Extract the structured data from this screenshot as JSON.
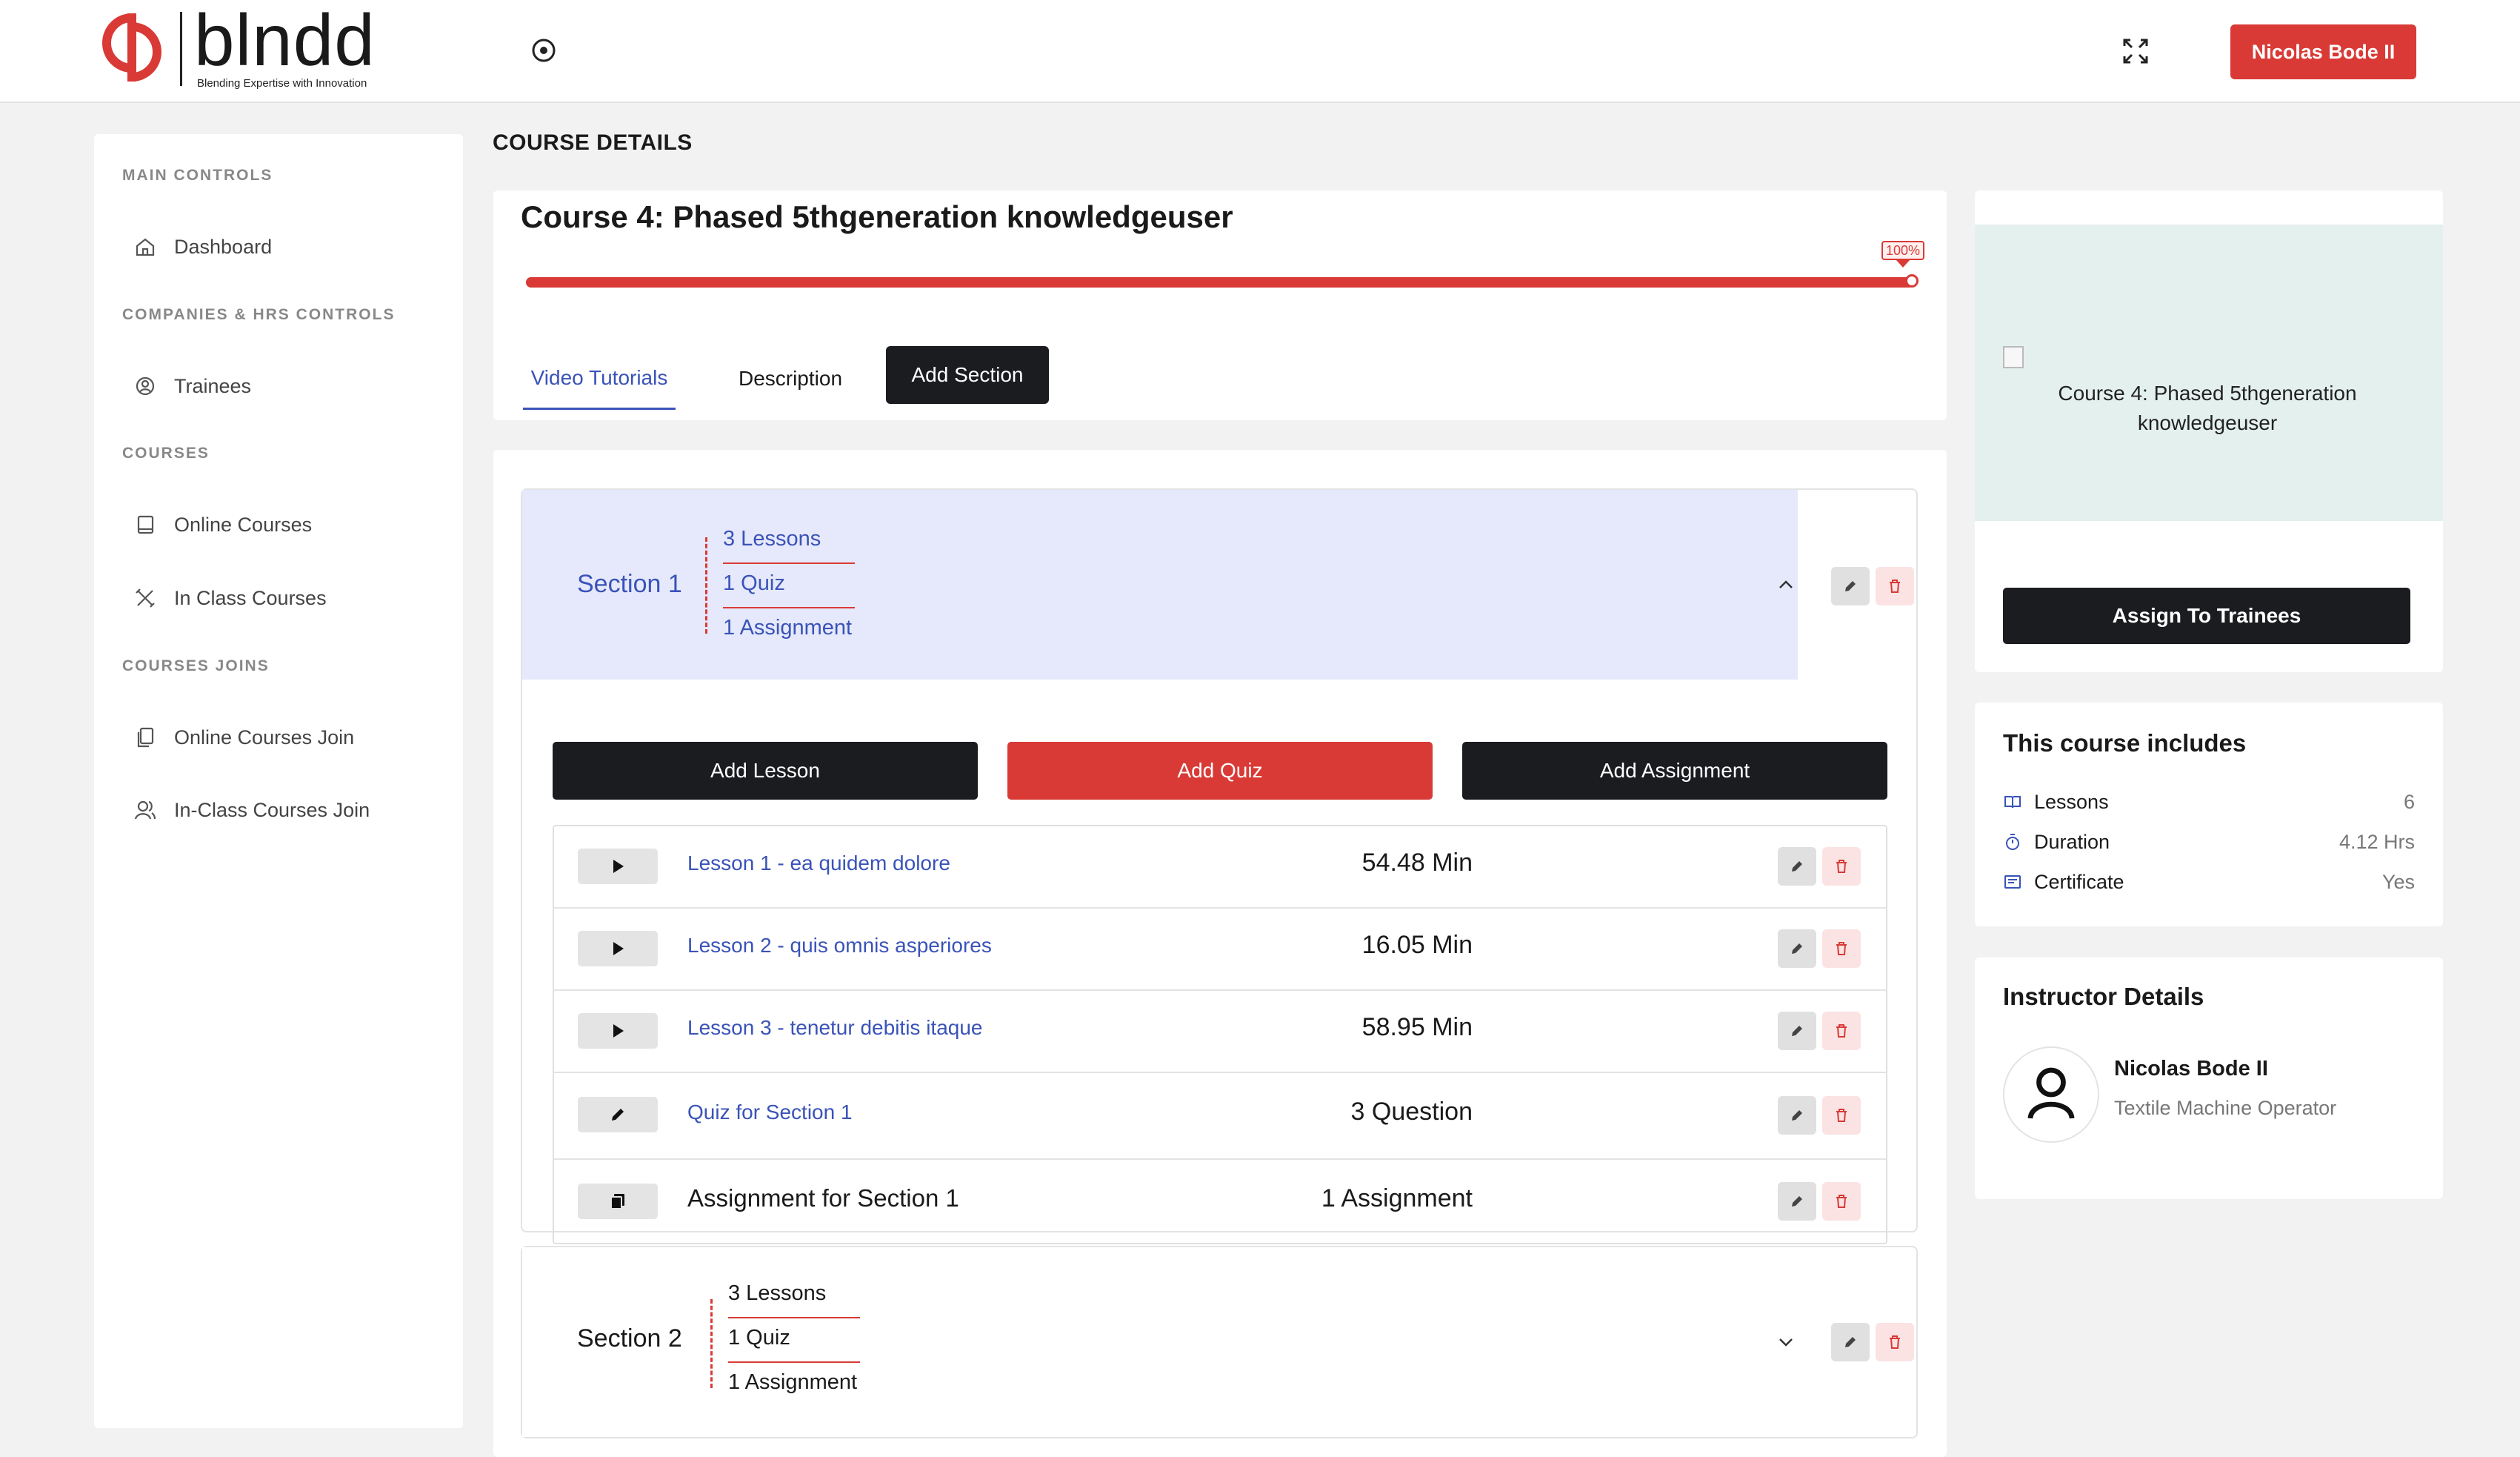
{
  "brand": {
    "name": "blndd",
    "tagline": "Blending Expertise with Innovation",
    "accent": "#d93a36",
    "dark": "#1b1c20",
    "link": "#3a53b8"
  },
  "header": {
    "user_button": "Nicolas Bode II",
    "icons": [
      "record-icon",
      "fullscreen-icon"
    ]
  },
  "sidebar": {
    "groups": [
      {
        "heading": "MAIN CONTROLS",
        "items": [
          {
            "label": "Dashboard",
            "icon": "home-icon"
          }
        ]
      },
      {
        "heading": "COMPANIES & HRS CONTROLS",
        "items": [
          {
            "label": "Trainees",
            "icon": "user-pin-icon"
          }
        ]
      },
      {
        "heading": "COURSES",
        "items": [
          {
            "label": "Online Courses",
            "icon": "book-icon"
          },
          {
            "label": "In Class Courses",
            "icon": "tools-icon"
          }
        ]
      },
      {
        "heading": "COURSES JOINS",
        "items": [
          {
            "label": "Online Courses Join",
            "icon": "copy-icon"
          },
          {
            "label": "In-Class Courses Join",
            "icon": "users-icon"
          }
        ]
      }
    ]
  },
  "page": {
    "title": "COURSE DETAILS"
  },
  "course": {
    "title": "Course 4: Phased 5thgeneration knowledgeuser",
    "progress_percent": 100,
    "progress_label": "100%",
    "tabs": [
      "Video Tutorials",
      "Description",
      "Add Section"
    ],
    "active_tab": "Video Tutorials"
  },
  "sections": [
    {
      "name": "Section 1",
      "expanded": true,
      "counts": [
        "3 Lessons",
        "1 Quiz",
        "1 Assignment"
      ],
      "actions": [
        "Add Lesson",
        "Add Quiz",
        "Add Assignment"
      ],
      "rows": [
        {
          "type": "lesson",
          "icon": "play-icon",
          "title": "Lesson 1 - ea quidem dolore",
          "meta": "54.48 Min"
        },
        {
          "type": "lesson",
          "icon": "play-icon",
          "title": "Lesson 2 - quis omnis asperiores",
          "meta": "16.05 Min"
        },
        {
          "type": "lesson",
          "icon": "play-icon",
          "title": "Lesson 3 - tenetur debitis itaque",
          "meta": "58.95 Min"
        },
        {
          "type": "quiz",
          "icon": "pencil-icon",
          "title": "Quiz for Section 1",
          "meta": "3 Question"
        },
        {
          "type": "assignment",
          "icon": "copy-icon",
          "title": "Assignment for Section 1",
          "meta": "1 Assignment"
        }
      ]
    },
    {
      "name": "Section 2",
      "expanded": false,
      "counts": [
        "3 Lessons",
        "1 Quiz",
        "1 Assignment"
      ]
    }
  ],
  "thumbnail": {
    "alt": "Course 4: Phased 5thgeneration knowledgeuser",
    "assign_button": "Assign To Trainees"
  },
  "includes": {
    "title": "This course includes",
    "items": [
      {
        "label": "Lessons",
        "value": "6",
        "icon": "book-open-icon"
      },
      {
        "label": "Duration",
        "value": "4.12 Hrs",
        "icon": "stopwatch-icon"
      },
      {
        "label": "Certificate",
        "value": "Yes",
        "icon": "certificate-icon"
      }
    ]
  },
  "instructor": {
    "title": "Instructor Details",
    "name": "Nicolas Bode II",
    "role": "Textile Machine Operator"
  }
}
